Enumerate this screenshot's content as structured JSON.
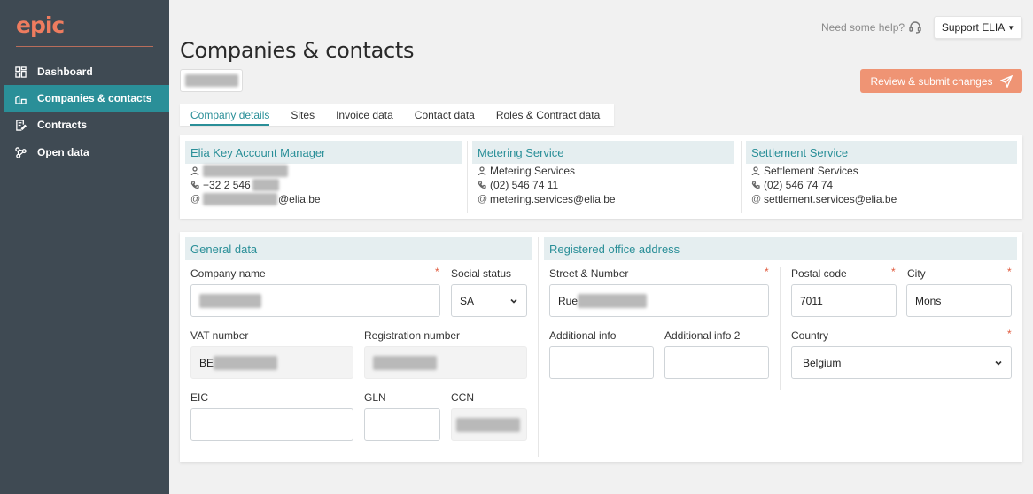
{
  "sidebar": {
    "logo": "epic",
    "items": [
      {
        "label": "Dashboard",
        "icon": "dashboard-icon"
      },
      {
        "label": "Companies & contacts",
        "icon": "buildings-icon"
      },
      {
        "label": "Contracts",
        "icon": "contract-icon"
      },
      {
        "label": "Open data",
        "icon": "network-icon"
      }
    ]
  },
  "header": {
    "help_text": "Need some help?",
    "support_label": "Support ELIA",
    "title": "Companies & contacts",
    "submit_label": "Review & submit changes"
  },
  "tabs": [
    {
      "label": "Company details",
      "active": true
    },
    {
      "label": "Sites"
    },
    {
      "label": "Invoice data"
    },
    {
      "label": "Contact data"
    },
    {
      "label": "Roles & Contract data"
    }
  ],
  "contacts": [
    {
      "title": "Elia Key Account Manager",
      "name": "",
      "phone": "+32 2 546",
      "email": "@elia.be"
    },
    {
      "title": "Metering Service",
      "name": "Metering Services",
      "phone": "(02) 546 74 11",
      "email": "metering.services@elia.be"
    },
    {
      "title": "Settlement Service",
      "name": "Settlement Services",
      "phone": "(02) 546 74 74",
      "email": "settlement.services@elia.be"
    }
  ],
  "general": {
    "title": "General data",
    "company_name_label": "Company name",
    "social_status_label": "Social status",
    "social_status_value": "SA",
    "vat_label": "VAT number",
    "vat_value": "BE",
    "registration_label": "Registration number",
    "eic_label": "EIC",
    "gln_label": "GLN",
    "ccn_label": "CCN"
  },
  "address": {
    "title": "Registered office address",
    "street_label": "Street & Number",
    "street_value": "Rue",
    "postal_label": "Postal code",
    "postal_value": "7011",
    "city_label": "City",
    "city_value": "Mons",
    "additional_label": "Additional info",
    "additional2_label": "Additional info 2",
    "country_label": "Country",
    "country_value": "Belgium"
  },
  "colors": {
    "sidebar": "#3f4a53",
    "accent": "#2a8f98",
    "brand": "#ee7c5f",
    "submit": "#ef9474",
    "required": "#e05b3f"
  }
}
